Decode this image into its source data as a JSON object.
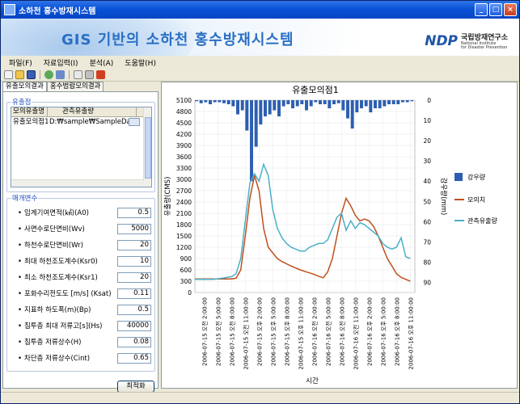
{
  "window": {
    "title": "소하천 홍수방재시스템",
    "buttons": [
      "_",
      "□",
      "×"
    ]
  },
  "banner": {
    "title": "GIS 기반의 소하천 홍수방재시스템",
    "logo_mark": "NDP",
    "logo_korean": "국립방재연구소",
    "logo_english_1": "National Institute",
    "logo_english_2": "for Disaster Prevention"
  },
  "menu": [
    "파일(F)",
    "자료입력(I)",
    "분석(A)",
    "도움말(H)"
  ],
  "toolbar": {
    "icons": [
      "new-icon",
      "open-icon",
      "save-icon",
      "map-icon",
      "layers-icon",
      "table-icon",
      "print-icon",
      "delete-icon"
    ]
  },
  "left": {
    "tabs": [
      "유출모의결과",
      "홍수범람모의결과"
    ],
    "outlet_group_title": "유출점",
    "list_headers": [
      "모의유출명",
      "관측유출량"
    ],
    "list_rows": [
      {
        "name": "유출모의점1",
        "path": "D:₩sample₩SampleData₩"
      }
    ],
    "params_group_title": "매개변수",
    "params": [
      {
        "label": "임계기여면적(㎢)(A0)",
        "value": "0.5"
      },
      {
        "label": "사면수로단면비(Wv)",
        "value": "5000"
      },
      {
        "label": "하천수로단면비(Wr)",
        "value": "20"
      },
      {
        "label": "최대 하천조도계수(Ksr0)",
        "value": "10"
      },
      {
        "label": "최소 하천조도계수(Ksr1)",
        "value": "20"
      },
      {
        "label": "포화수리전도도 [m/s] (Ksat)",
        "value": "0.11"
      },
      {
        "label": "지표하 하도폭(m)(Bp)",
        "value": "0.5"
      },
      {
        "label": "침투층 최대 저류고[s](Hs)",
        "value": "40000"
      },
      {
        "label": "침투층 저류상수(H)",
        "value": "0.08"
      },
      {
        "label": "차단층 저류상수(Cint)",
        "value": "0.65"
      }
    ],
    "optimize_button": "최적화"
  },
  "chart_data": {
    "type": "line",
    "title": "유출모의점1",
    "xlabel": "시간",
    "ylabel": "유출량(CMS)",
    "ylabel_right": "강우량(mm)",
    "ylim": [
      0,
      5100
    ],
    "ylim_right": [
      0,
      95
    ],
    "y_ticks": [
      0,
      300,
      600,
      900,
      1200,
      1500,
      1800,
      2100,
      2400,
      2700,
      3000,
      3300,
      3600,
      3900,
      4200,
      4500,
      4800,
      5100
    ],
    "y_ticks_right": [
      0,
      10,
      20,
      30,
      40,
      50,
      60,
      70,
      80,
      90
    ],
    "x_ticks": [
      "2006-07-15 오전 2:00:00",
      "2006-07-15 오전 5:00:00",
      "2006-07-15 오전 8:00:00",
      "2006-07-15 오전 11:00:00",
      "2006-07-15 오후 2:00:00",
      "2006-07-15 오후 5:00:00",
      "2006-07-15 오후 8:00:00",
      "2006-07-15 오후 11:00:00",
      "2006-07-16 오전 2:00:00",
      "2006-07-16 오전 5:00:00",
      "2006-07-16 오전 8:00:00",
      "2006-07-16 오전 11:00:00",
      "2006-07-16 오후 2:00:00",
      "2006-07-16 오후 5:00:00",
      "2006-07-16 오후 8:00:00",
      "2006-07-16 오후 11:00:00"
    ],
    "legend": [
      "강우량",
      "모의치",
      "관측유출량"
    ],
    "legend_position": "right",
    "colors": {
      "rain": "#2d5fb0",
      "simulated": "#c0501e",
      "observed": "#4ab0c8"
    },
    "x_range": [
      0,
      48
    ],
    "rainfall": {
      "x": [
        0,
        1,
        2,
        3,
        4,
        5,
        6,
        7,
        8,
        9,
        10,
        11,
        12,
        13,
        14,
        15,
        16,
        17,
        18,
        19,
        20,
        21,
        22,
        23,
        24,
        25,
        26,
        27,
        28,
        29,
        30,
        31,
        32,
        33,
        34,
        35,
        36,
        37,
        38,
        39,
        40,
        41,
        42,
        43,
        44,
        45,
        46,
        47
      ],
      "values": [
        0.5,
        1.5,
        1,
        2,
        1,
        1,
        1.5,
        2,
        3,
        7,
        5,
        15,
        40,
        23,
        12,
        8,
        7,
        5,
        8,
        3,
        2,
        4,
        3,
        2,
        5,
        3,
        1,
        2,
        2,
        4,
        2,
        1.5,
        5,
        9,
        14,
        6,
        4,
        3,
        6,
        4,
        4,
        3,
        2,
        2,
        2,
        1,
        1,
        0.5
      ]
    },
    "series": [
      {
        "name": "모의치",
        "x": [
          0,
          2,
          4,
          6,
          8,
          9,
          10,
          11,
          12,
          13,
          14,
          15,
          16,
          17,
          18,
          19,
          20,
          21,
          22,
          23,
          24,
          25,
          26,
          27,
          28,
          29,
          30,
          31,
          32,
          33,
          34,
          35,
          36,
          37,
          38,
          39,
          40,
          41,
          42,
          43,
          44,
          45,
          46,
          47
        ],
        "values": [
          360,
          360,
          360,
          360,
          360,
          380,
          600,
          1500,
          2500,
          3100,
          2700,
          1700,
          1200,
          1050,
          900,
          820,
          760,
          700,
          650,
          600,
          560,
          520,
          480,
          430,
          390,
          550,
          900,
          1500,
          2100,
          2500,
          2300,
          2050,
          1900,
          1950,
          1900,
          1750,
          1500,
          1200,
          900,
          700,
          500,
          400,
          350,
          300
        ]
      },
      {
        "name": "관측유출량",
        "x": [
          0,
          2,
          4,
          6,
          8,
          9,
          10,
          11,
          12,
          13,
          14,
          15,
          16,
          17,
          18,
          19,
          20,
          21,
          22,
          23,
          24,
          25,
          26,
          27,
          28,
          29,
          30,
          31,
          32,
          33,
          34,
          35,
          36,
          37,
          38,
          39,
          40,
          41,
          42,
          43,
          44,
          45,
          46,
          47
        ],
        "values": [
          350,
          350,
          350,
          380,
          420,
          500,
          900,
          1900,
          2900,
          3150,
          2950,
          3400,
          3100,
          2200,
          1700,
          1450,
          1300,
          1200,
          1150,
          1100,
          1100,
          1200,
          1250,
          1300,
          1300,
          1400,
          1700,
          2000,
          2100,
          1650,
          1900,
          1700,
          1850,
          1800,
          1700,
          1600,
          1500,
          1300,
          1200,
          1150,
          1200,
          1450,
          950,
          900
        ]
      }
    ]
  }
}
